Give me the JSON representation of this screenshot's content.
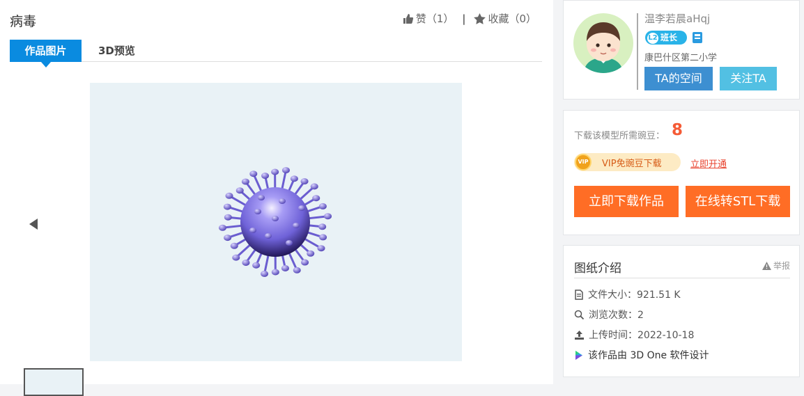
{
  "work": {
    "title": "病毒"
  },
  "actions": {
    "like_label": "赞",
    "like_count": "（1）",
    "separator": "|",
    "fav_label": "收藏",
    "fav_count": "（0）"
  },
  "tabs": [
    {
      "label": "作品图片",
      "active": true
    },
    {
      "label": "3D预览",
      "active": false
    }
  ],
  "author": {
    "name": "温李若晨aHqj",
    "level": "L2",
    "level_title": "班长",
    "school": "康巴什区第二小学",
    "space_button": "TA的空间",
    "follow_button": "关注TA"
  },
  "download": {
    "beans_label": "下载该模型所需豌豆：",
    "beans_value": "8",
    "vip_badge": "VIP",
    "vip_label": "VIP免豌豆下载",
    "vip_link": "立即开通",
    "download_button": "立即下载作品",
    "stl_button": "在线转STL下载"
  },
  "intro": {
    "title": "图纸介绍",
    "report": "举报",
    "file_size": "文件大小：921.51 K",
    "views": "浏览次数：2",
    "upload_time": "上传时间：2022-10-18",
    "software": "该作品由 3D One 软件设计"
  },
  "colors": {
    "accent_blue": "#0a8be0",
    "download_orange": "#ff6d25",
    "beans_red": "#f55b36",
    "virus_purple": "#7a6fe0"
  }
}
